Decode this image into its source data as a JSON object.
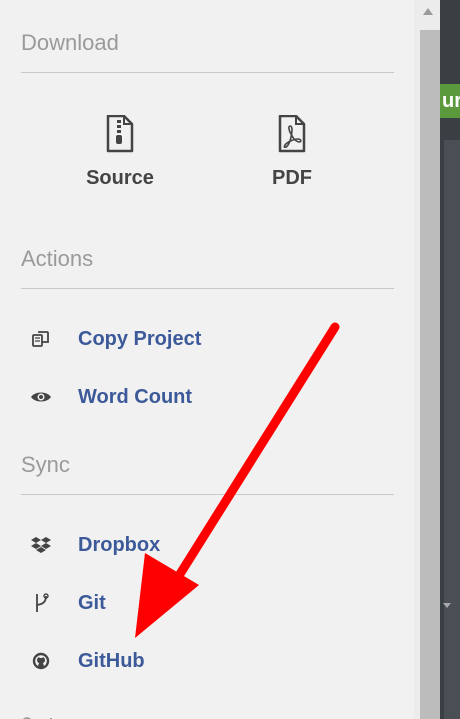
{
  "download": {
    "title": "Download",
    "items": [
      {
        "label": "Source",
        "icon": "file-archive-icon"
      },
      {
        "label": "PDF",
        "icon": "file-pdf-icon"
      }
    ]
  },
  "actions": {
    "title": "Actions",
    "items": [
      {
        "label": "Copy Project",
        "icon": "copy-icon"
      },
      {
        "label": "Word Count",
        "icon": "eye-icon"
      }
    ]
  },
  "sync": {
    "title": "Sync",
    "items": [
      {
        "label": "Dropbox",
        "icon": "dropbox-icon"
      },
      {
        "label": "Git",
        "icon": "git-icon"
      },
      {
        "label": "GitHub",
        "icon": "github-icon"
      }
    ]
  },
  "background": {
    "button_partial_text": "ur"
  },
  "colors": {
    "link": "#3c5a99",
    "annotation_arrow": "#ff0000",
    "panel_bg": "#f1f1f1"
  }
}
